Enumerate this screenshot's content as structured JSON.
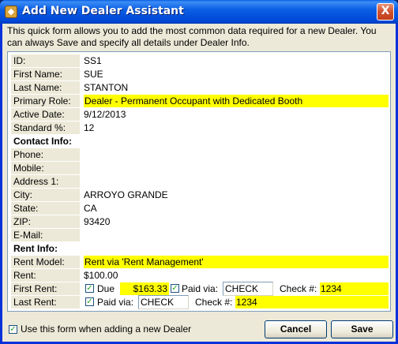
{
  "window": {
    "title": "Add New Dealer Assistant",
    "close_glyph": "X",
    "intro": "This quick form allows you to add the most common data required for a new Dealer.  You can always Save and specify all details under Dealer Info."
  },
  "fields": [
    {
      "label": "ID:",
      "value": "SS1"
    },
    {
      "label": "First Name:",
      "value": "SUE"
    },
    {
      "label": "Last Name:",
      "value": "STANTON"
    },
    {
      "label": "Primary Role:",
      "value": "Dealer - Permanent Occupant with Dedicated Booth"
    },
    {
      "label": "Active Date:",
      "value": "9/12/2013"
    },
    {
      "label": "Standard %:",
      "value": "12"
    }
  ],
  "contact": {
    "section_label": "Contact Info:",
    "fields": [
      {
        "label": "Phone:",
        "value": ""
      },
      {
        "label": "Mobile:",
        "value": ""
      },
      {
        "label": "Address 1:",
        "value": ""
      },
      {
        "label": "City:",
        "value": "ARROYO GRANDE"
      },
      {
        "label": "State:",
        "value": "CA"
      },
      {
        "label": "ZIP:",
        "value": "93420"
      },
      {
        "label": "E-Mail:",
        "value": ""
      }
    ]
  },
  "rent": {
    "section_label": "Rent Info:",
    "model_label": "Rent Model:",
    "model_value": "Rent via 'Rent Management'",
    "rent_label": "Rent:",
    "rent_value": "$100.00",
    "first_rent": {
      "label": "First Rent:",
      "due_label": "Due",
      "due_checked": true,
      "due_amount": "$163.33",
      "paid_checked": true,
      "paid_via_label": "Paid via:",
      "paid_via_value": "CHECK",
      "check_label": "Check #:",
      "check_value": "1234"
    },
    "last_rent": {
      "label": "Last Rent:",
      "paid_checked": true,
      "paid_via_label": "Paid via:",
      "paid_via_value": "CHECK",
      "check_label": "Check #:",
      "check_value": "1234"
    }
  },
  "footer": {
    "use_form_checked": true,
    "use_form_label": "Use this form when adding a new Dealer",
    "cancel_label": "Cancel",
    "save_label": "Save"
  },
  "colors": {
    "highlight": "#ffff00",
    "titlebar": "#0b5fe4",
    "window_bg": "#ece9d8"
  }
}
